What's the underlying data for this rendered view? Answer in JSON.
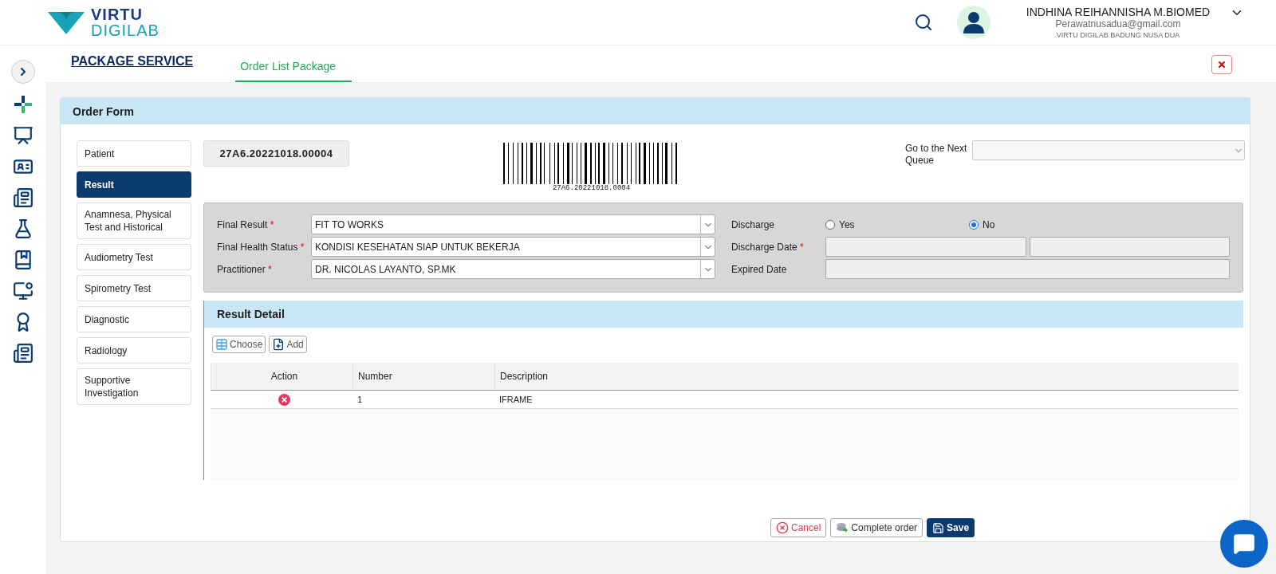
{
  "header": {
    "logo": {
      "line1": "VIRTU",
      "line2": "DIGILAB"
    },
    "user": {
      "name": "INDHINA REIHANNISHA M.BIOMED",
      "email": "Perawatnusadua@gmail.com",
      "org": "VIRTU DIGILAB BADUNG NUSA DUA"
    }
  },
  "page_title": "PACKAGE SERVICE",
  "tabs": [
    {
      "label": "Order List Package",
      "selected": true
    }
  ],
  "order_form": {
    "title": "Order Form",
    "nav": [
      {
        "label": "Patient",
        "selected": false
      },
      {
        "label": "Result",
        "selected": true
      },
      {
        "label": "Anamnesa, Physical Test and Historical",
        "selected": false
      },
      {
        "label": "Audiometry Test",
        "selected": false
      },
      {
        "label": "Spirometry Test",
        "selected": false
      },
      {
        "label": "Diagnostic",
        "selected": false
      },
      {
        "label": "Radiology",
        "selected": false
      },
      {
        "label": "Supportive Investigation",
        "selected": false
      }
    ],
    "order_number": "27A6.20221018.00004",
    "barcode_text": "27A6.20221018.0004",
    "next_queue": {
      "label": "Go to the Next Queue"
    },
    "left_fields": [
      {
        "label": "Final Result",
        "marker": "*",
        "value": "FIT TO WORKS"
      },
      {
        "label": "Final Health Status",
        "marker": "*",
        "value": "KONDISI KESEHATAN SIAP UNTUK BEKERJA"
      },
      {
        "label": "Practitioner",
        "marker": "*",
        "value": "DR. NICOLAS LAYANTO, SP.MK"
      }
    ],
    "right_fields": [
      {
        "kind": "radio",
        "label": "Discharge",
        "options": [
          {
            "label": "Yes",
            "selected": false
          },
          {
            "label": "No",
            "selected": true
          }
        ]
      },
      {
        "kind": "range",
        "label": "Discharge Date",
        "marker": "*"
      },
      {
        "kind": "text",
        "label": "Expired Date"
      }
    ],
    "result_detail": {
      "title": "Result Detail",
      "buttons": [
        {
          "kind": "choose",
          "label": "Choose"
        },
        {
          "kind": "add",
          "label": "Add"
        }
      ],
      "columns": [
        "Action",
        "Number",
        "Description"
      ],
      "rows": [
        {
          "number": "1",
          "description": "IFRAME"
        }
      ]
    },
    "actions": [
      {
        "kind": "cancel",
        "label": "Cancel"
      },
      {
        "kind": "complete",
        "label": "Complete order"
      },
      {
        "kind": "save",
        "label": "Save"
      }
    ]
  }
}
